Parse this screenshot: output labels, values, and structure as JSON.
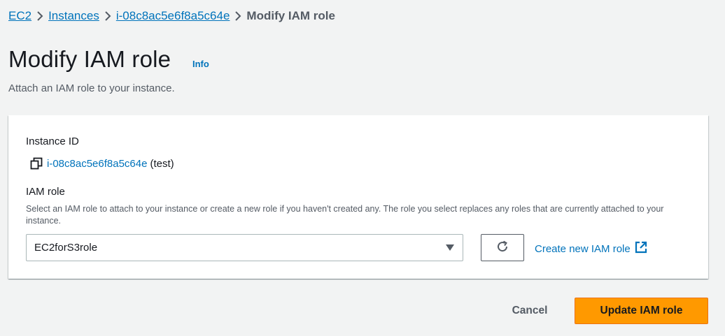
{
  "breadcrumb": {
    "items": [
      {
        "label": "EC2",
        "link": true
      },
      {
        "label": "Instances",
        "link": true
      },
      {
        "label": "i-08c8ac5e6f8a5c64e",
        "link": true
      },
      {
        "label": "Modify IAM role",
        "link": false
      }
    ]
  },
  "header": {
    "title": "Modify IAM role",
    "info_label": "Info",
    "description": "Attach an IAM role to your instance."
  },
  "instance": {
    "label": "Instance ID",
    "id": "i-08c8ac5e6f8a5c64e",
    "name": "(test)"
  },
  "iam_role": {
    "label": "IAM role",
    "description": "Select an IAM role to attach to your instance or create a new role if you haven't created any. The role you select replaces any roles that are currently attached to your instance.",
    "selected_value": "EC2forS3role",
    "create_link_label": "Create new IAM role"
  },
  "footer": {
    "cancel_label": "Cancel",
    "update_label": "Update IAM role"
  },
  "colors": {
    "link": "#0073bb",
    "primary_button": "#ff9900",
    "background": "#f2f3f3"
  }
}
